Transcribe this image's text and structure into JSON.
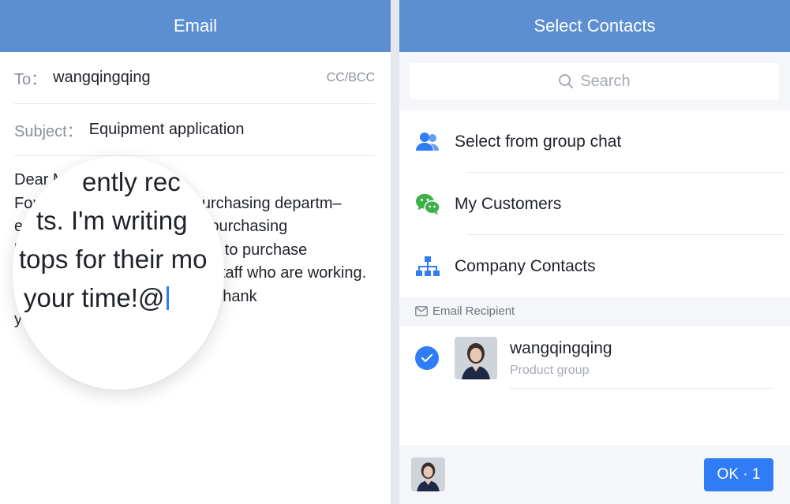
{
  "email": {
    "title": "Email",
    "to_label": "To：",
    "to_value": "wangqingqing",
    "cc_label": "CC/BCC",
    "subject_label": "Subject：",
    "subject_value": "Equipment application",
    "body_lines": [
      "Dear Manager Wang:",
      "For recently reasons, the purchasing departm–",
      "ents. I'm writing for and two purchasing",
      "laptops for their more request to purchase",
      "staff who are working. Thank",
      "you for your time!@"
    ],
    "magnifier_lines": [
      "ently rec",
      "ts. I'm writing",
      "tops for their mo",
      "your time!@"
    ]
  },
  "contacts": {
    "title": "Select Contacts",
    "search_placeholder": "Search",
    "menu": [
      {
        "label": "Select from group chat",
        "icon": "group-icon"
      },
      {
        "label": "My Customers",
        "icon": "wechat-icon"
      },
      {
        "label": "Company Contacts",
        "icon": "org-chart-icon"
      }
    ],
    "section_label": "Email Recipient",
    "recipient": {
      "name": "wangqingqing",
      "group": "Product group",
      "selected": true
    },
    "ok_label": "OK · 1"
  },
  "colors": {
    "header": "#5b8fd1",
    "accent": "#2f7cf6",
    "wechat": "#3fb049"
  }
}
